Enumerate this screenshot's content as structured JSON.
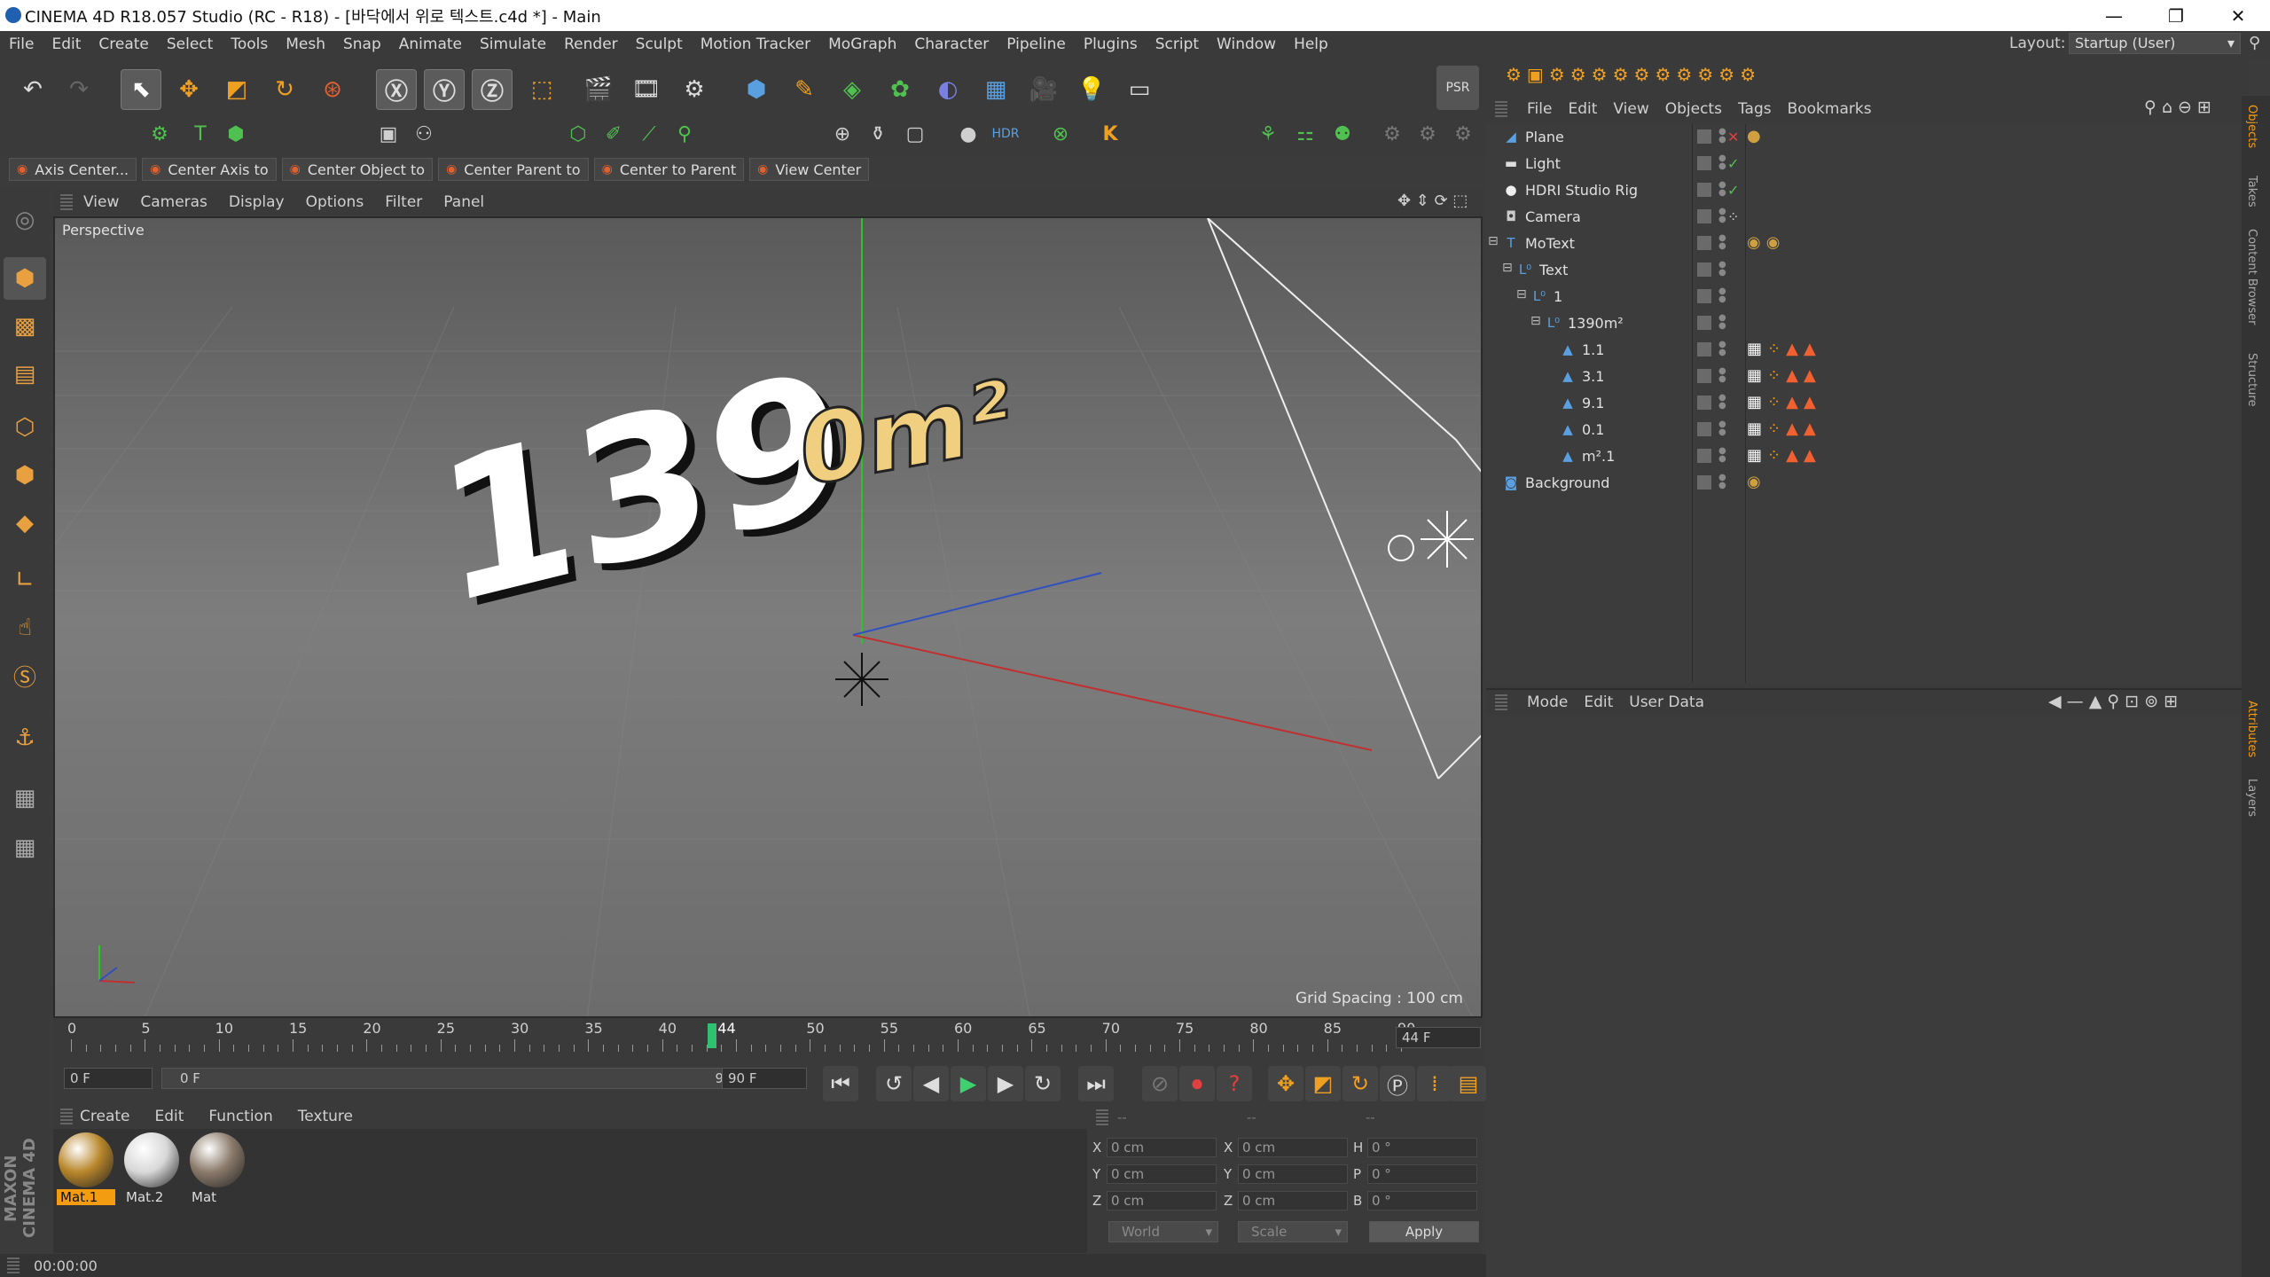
{
  "window": {
    "title": "CINEMA 4D R18.057 Studio (RC - R18) - [바닥에서 위로 텍스트.c4d *] - Main",
    "minimize": "—",
    "restore": "❐",
    "close": "✕"
  },
  "menubar": {
    "items": [
      "File",
      "Edit",
      "Create",
      "Select",
      "Tools",
      "Mesh",
      "Snap",
      "Animate",
      "Simulate",
      "Render",
      "Sculpt",
      "Motion Tracker",
      "MoGraph",
      "Character",
      "Pipeline",
      "Plugins",
      "Script",
      "Window",
      "Help"
    ],
    "layout_label": "Layout:",
    "layout_value": "Startup (User)"
  },
  "center_bar": {
    "items": [
      "Axis Center...",
      "Center Axis to",
      "Center Object to",
      "Center Parent to",
      "Center to Parent",
      "View Center"
    ]
  },
  "viewport": {
    "menu": [
      "View",
      "Cameras",
      "Display",
      "Options",
      "Filter",
      "Panel"
    ],
    "label": "Perspective",
    "grid_spacing": "Grid Spacing : 100 cm",
    "overlay_text_main": "139",
    "overlay_text_units": "0m²"
  },
  "timeline": {
    "ticks": [
      "0",
      "5",
      "10",
      "15",
      "20",
      "25",
      "30",
      "35",
      "40",
      "44",
      "50",
      "55",
      "60",
      "65",
      "70",
      "75",
      "80",
      "85",
      "90"
    ],
    "current_frame": "44 F",
    "start_field": "0 F",
    "range_start": "0 F",
    "range_end": "90 F",
    "end_field": "90 F"
  },
  "material_manager": {
    "menu": [
      "Create",
      "Edit",
      "Function",
      "Texture"
    ],
    "materials": [
      {
        "name": "Mat.1",
        "color": "#b8862a"
      },
      {
        "name": "Mat.2",
        "color": "#d8d8d8"
      },
      {
        "name": "Mat",
        "color": "#8a7a6a"
      }
    ]
  },
  "coordinates": {
    "header": [
      "--",
      "--",
      "--"
    ],
    "rows": [
      {
        "a": "X",
        "av": "0 cm",
        "b": "X",
        "bv": "0 cm",
        "c": "H",
        "cv": "0 °"
      },
      {
        "a": "Y",
        "av": "0 cm",
        "b": "Y",
        "bv": "0 cm",
        "c": "P",
        "cv": "0 °"
      },
      {
        "a": "Z",
        "av": "0 cm",
        "b": "Z",
        "bv": "0 cm",
        "c": "B",
        "cv": "0 °"
      }
    ],
    "world": "World",
    "scale": "Scale",
    "apply": "Apply"
  },
  "status": {
    "time": "00:00:00"
  },
  "maxon_logo": "MAXON CINEMA 4D",
  "object_manager": {
    "menu": [
      "File",
      "Edit",
      "View",
      "Objects",
      "Tags",
      "Bookmarks"
    ],
    "objects": [
      {
        "name": "Plane",
        "icon": "plane-icon",
        "glyph": "◢",
        "color": "#5aa0e0",
        "level": 0,
        "status": "✕",
        "status_color": "#e04040",
        "tags": [
          "●"
        ]
      },
      {
        "name": "Light",
        "icon": "light-icon",
        "glyph": "▬",
        "color": "#dddddd",
        "level": 0,
        "status": "✓",
        "status_color": "#50c050",
        "tags": []
      },
      {
        "name": "HDRI Studio Rig",
        "icon": "hdri-icon",
        "glyph": "●",
        "color": "#eeeeee",
        "level": 0,
        "status": "✓",
        "status_color": "#50c050",
        "tags": []
      },
      {
        "name": "Camera",
        "icon": "camera-icon",
        "glyph": "◘",
        "color": "#cccccc",
        "level": 0,
        "status": "⁘",
        "status_color": "#cccccc",
        "tags": []
      },
      {
        "name": "MoText",
        "icon": "motext-icon",
        "glyph": "T",
        "color": "#5aa0e0",
        "level": 0,
        "status": "",
        "status_color": "#cccccc",
        "tags": [
          "◉",
          "◉"
        ]
      },
      {
        "name": "Text",
        "icon": "null-icon",
        "glyph": "L⁰",
        "color": "#5aa0e0",
        "level": 1,
        "status": "",
        "status_color": "#cccccc",
        "tags": []
      },
      {
        "name": "1",
        "icon": "null-icon",
        "glyph": "L⁰",
        "color": "#5aa0e0",
        "level": 2,
        "status": "",
        "status_color": "#cccccc",
        "tags": []
      },
      {
        "name": "1390m²",
        "icon": "null-icon",
        "glyph": "L⁰",
        "color": "#5aa0e0",
        "level": 3,
        "status": "",
        "status_color": "#cccccc",
        "tags": []
      },
      {
        "name": "1.1",
        "icon": "extrude-icon",
        "glyph": "▲",
        "color": "#5aa0e0",
        "level": 4,
        "status": "",
        "status_color": "#cccccc",
        "tags": [
          "▦",
          "⁘",
          "▲",
          "▲"
        ]
      },
      {
        "name": "3.1",
        "icon": "extrude-icon",
        "glyph": "▲",
        "color": "#5aa0e0",
        "level": 4,
        "status": "",
        "status_color": "#cccccc",
        "tags": [
          "▦",
          "⁘",
          "▲",
          "▲"
        ]
      },
      {
        "name": "9.1",
        "icon": "extrude-icon",
        "glyph": "▲",
        "color": "#5aa0e0",
        "level": 4,
        "status": "",
        "status_color": "#cccccc",
        "tags": [
          "▦",
          "⁘",
          "▲",
          "▲"
        ]
      },
      {
        "name": "0.1",
        "icon": "extrude-icon",
        "glyph": "▲",
        "color": "#5aa0e0",
        "level": 4,
        "status": "",
        "status_color": "#cccccc",
        "tags": [
          "▦",
          "⁘",
          "▲",
          "▲"
        ]
      },
      {
        "name": "m².1",
        "icon": "extrude-icon",
        "glyph": "▲",
        "color": "#5aa0e0",
        "level": 4,
        "status": "",
        "status_color": "#cccccc",
        "tags": [
          "▦",
          "⁘",
          "▲",
          "▲"
        ]
      },
      {
        "name": "Background",
        "icon": "background-icon",
        "glyph": "◙",
        "color": "#5aa0e0",
        "level": 0,
        "status": "",
        "status_color": "#cccccc",
        "tags": [
          "◉"
        ]
      }
    ]
  },
  "attributes": {
    "menu": [
      "Mode",
      "Edit",
      "User Data"
    ]
  },
  "side_tabs": {
    "top": [
      "Objects",
      "Takes",
      "Content Browser",
      "Structure"
    ],
    "bottom": [
      "Attributes",
      "Layers"
    ]
  },
  "colors": {
    "accent": "#f39c12",
    "bg": "#3b3b3b"
  }
}
